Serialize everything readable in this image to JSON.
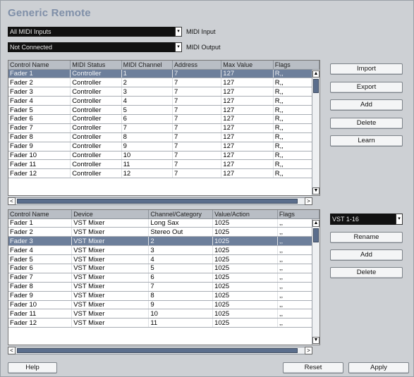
{
  "window": {
    "title": "Generic Remote"
  },
  "midi_input": {
    "value": "All MIDI Inputs",
    "label": "MIDI Input"
  },
  "midi_output": {
    "value": "Not Connected",
    "label": "MIDI Output"
  },
  "upper_table": {
    "columns": [
      "Control Name",
      "MIDI Status",
      "MIDI Channel",
      "Address",
      "Max Value",
      "Flags"
    ],
    "rows": [
      [
        "Fader 1",
        "Controller",
        "1",
        "7",
        "127",
        "R,,"
      ],
      [
        "Fader 2",
        "Controller",
        "2",
        "7",
        "127",
        "R,,"
      ],
      [
        "Fader 3",
        "Controller",
        "3",
        "7",
        "127",
        "R,,"
      ],
      [
        "Fader 4",
        "Controller",
        "4",
        "7",
        "127",
        "R,,"
      ],
      [
        "Fader 5",
        "Controller",
        "5",
        "7",
        "127",
        "R,,"
      ],
      [
        "Fader 6",
        "Controller",
        "6",
        "7",
        "127",
        "R,,"
      ],
      [
        "Fader 7",
        "Controller",
        "7",
        "7",
        "127",
        "R,,"
      ],
      [
        "Fader 8",
        "Controller",
        "8",
        "7",
        "127",
        "R,,"
      ],
      [
        "Fader 9",
        "Controller",
        "9",
        "7",
        "127",
        "R,,"
      ],
      [
        "Fader 10",
        "Controller",
        "10",
        "7",
        "127",
        "R,,"
      ],
      [
        "Fader 11",
        "Controller",
        "11",
        "7",
        "127",
        "R,,"
      ],
      [
        "Fader 12",
        "Controller",
        "12",
        "7",
        "127",
        "R,,"
      ]
    ]
  },
  "lower_table": {
    "columns": [
      "Control Name",
      "Device",
      "Channel/Category",
      "Value/Action",
      "Flags"
    ],
    "rows": [
      [
        "Fader 1",
        "VST Mixer",
        "Long Sax",
        "1025",
        ",,"
      ],
      [
        "Fader 2",
        "VST Mixer",
        "Stereo Out",
        "1025",
        ",,"
      ],
      [
        "Fader 3",
        "VST Mixer",
        "2",
        "1025",
        ",,"
      ],
      [
        "Fader 4",
        "VST Mixer",
        "3",
        "1025",
        ",,"
      ],
      [
        "Fader 5",
        "VST Mixer",
        "4",
        "1025",
        ",,"
      ],
      [
        "Fader 6",
        "VST Mixer",
        "5",
        "1025",
        ",,"
      ],
      [
        "Fader 7",
        "VST Mixer",
        "6",
        "1025",
        ",,"
      ],
      [
        "Fader 8",
        "VST Mixer",
        "7",
        "1025",
        ",,"
      ],
      [
        "Fader 9",
        "VST Mixer",
        "8",
        "1025",
        ",,"
      ],
      [
        "Fader 10",
        "VST Mixer",
        "9",
        "1025",
        ",,"
      ],
      [
        "Fader 11",
        "VST Mixer",
        "10",
        "1025",
        ",,"
      ],
      [
        "Fader 12",
        "VST Mixer",
        "11",
        "1025",
        ",,"
      ]
    ]
  },
  "upper_buttons": {
    "import": "Import",
    "export": "Export",
    "add": "Add",
    "delete": "Delete",
    "learn": "Learn"
  },
  "bank_select": {
    "value": "VST 1-16"
  },
  "lower_buttons": {
    "rename": "Rename",
    "add": "Add",
    "delete": "Delete"
  },
  "footer": {
    "help": "Help",
    "reset": "Reset",
    "apply": "Apply"
  },
  "glyphs": {
    "dropdown": "▾",
    "scroll_up": "▲",
    "scroll_down": "▼",
    "scroll_left": "<",
    "scroll_right": ">"
  },
  "colors": {
    "selection": "#6d7f9b",
    "title": "#7f8fa8",
    "scroll_thumb": "#5b6e8c"
  }
}
